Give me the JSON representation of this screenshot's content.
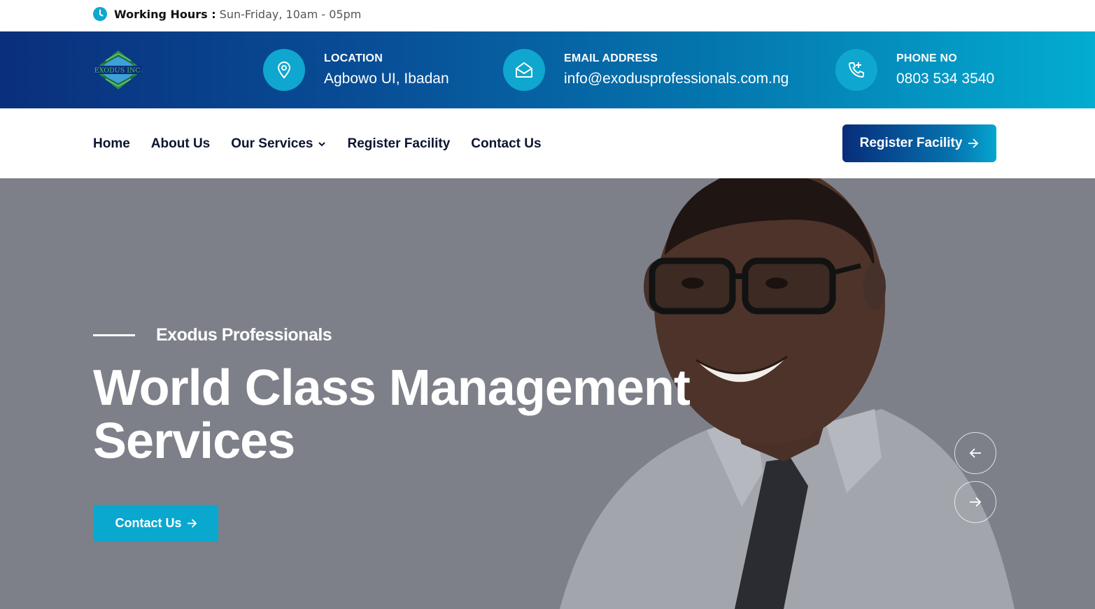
{
  "topbar": {
    "hours_label": "Working Hours :",
    "hours_value": "Sun-Friday, 10am - 05pm"
  },
  "header": {
    "logo_text": "EXODUS INC.",
    "location": {
      "label": "LOCATION",
      "value": "Agbowo UI, Ibadan"
    },
    "email": {
      "label": "EMAIL ADDRESS",
      "value": "info@exodusprofessionals.com.ng"
    },
    "phone": {
      "label": "PHONE NO",
      "value": "0803 534 3540"
    }
  },
  "nav": {
    "items": [
      "Home",
      "About Us",
      "Our Services",
      "Register Facility",
      "Contact Us"
    ],
    "cta_label": "Register Facility"
  },
  "hero": {
    "eyebrow": "Exodus Professionals",
    "headline_line1": "World Class Management",
    "headline_line2": "Services",
    "cta_label": "Contact Us"
  },
  "colors": {
    "brand_dark": "#0a2f7c",
    "brand_cyan": "#0aa7cf",
    "hero_overlay": "#7e8089"
  }
}
